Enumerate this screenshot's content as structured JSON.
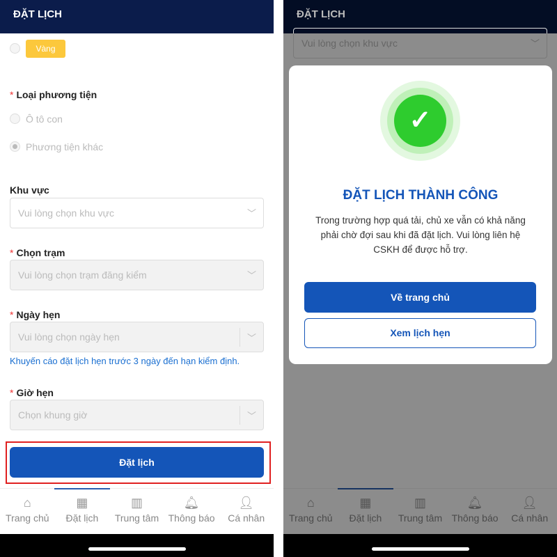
{
  "header": {
    "title": "ĐẶT LỊCH"
  },
  "form": {
    "color_option": "Vàng",
    "vehicle_type": {
      "label": "Loại phương tiện",
      "options": [
        "Ô tô con",
        "Phương tiện khác"
      ],
      "selected": "Phương tiện khác"
    },
    "region": {
      "label": "Khu vực",
      "placeholder": "Vui lòng chọn khu vực"
    },
    "station": {
      "label": "Chọn trạm",
      "placeholder": "Vui lòng chọn trạm đăng kiểm"
    },
    "date": {
      "label": "Ngày hẹn",
      "placeholder": "Vui lòng chọn ngày hẹn",
      "hint": "Khuyến cáo đặt lịch hẹn trước 3 ngày đến hạn kiểm định."
    },
    "time": {
      "label": "Giờ hẹn",
      "placeholder": "Chọn khung giờ"
    },
    "required_mark": "*",
    "submit": "Đặt lịch"
  },
  "nav": {
    "items": [
      {
        "label": "Trang chủ",
        "icon": "home-icon"
      },
      {
        "label": "Đặt lịch",
        "icon": "calendar-icon",
        "active": true
      },
      {
        "label": "Trung tâm",
        "icon": "building-icon"
      },
      {
        "label": "Thông báo",
        "icon": "bell-icon"
      },
      {
        "label": "Cá nhân",
        "icon": "user-icon"
      }
    ]
  },
  "modal": {
    "title": "ĐẶT LỊCH THÀNH CÔNG",
    "message": "Trong trường hợp quá tải, chủ xe vẫn có khả năng phải chờ đợi sau khi đã đặt lịch. Vui lòng liên hệ CSKH để được hỗ trợ.",
    "primary": "Về trang chủ",
    "secondary": "Xem lịch hẹn"
  },
  "colors": {
    "header": "#0b1c4b",
    "primary": "#1455b8",
    "accent_yellow": "#fcc83c",
    "success": "#2ecc2e",
    "highlight_box": "#e02020"
  }
}
